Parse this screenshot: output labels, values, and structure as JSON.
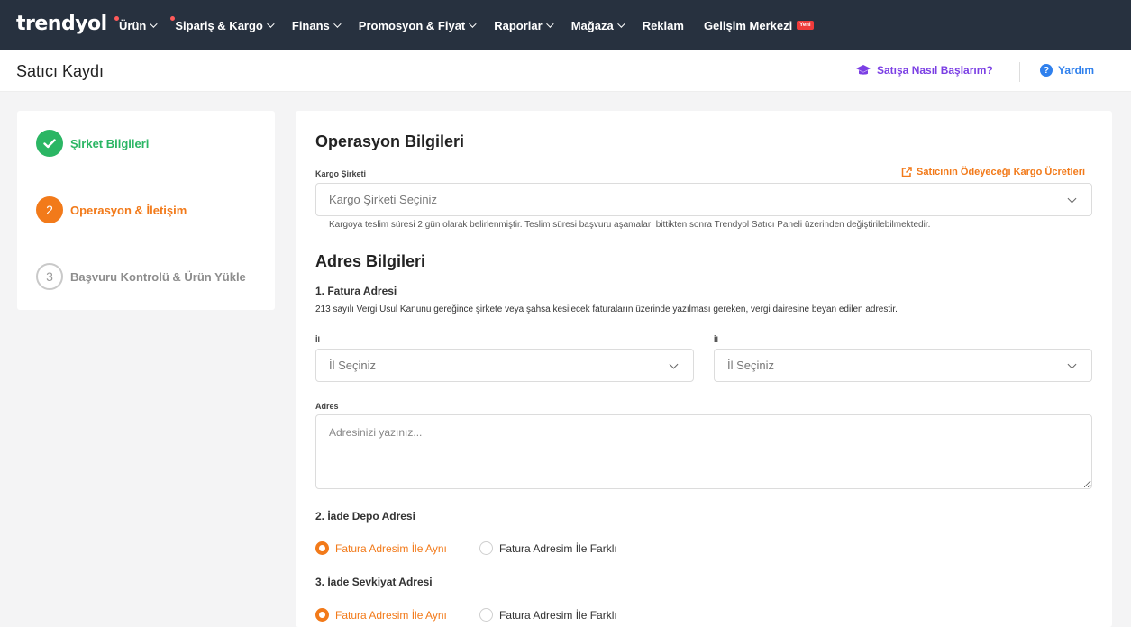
{
  "brand": {
    "logo_text": "trendyol"
  },
  "nav": {
    "items": [
      {
        "label": "Ürün",
        "dot": true
      },
      {
        "label": "Sipariş & Kargo",
        "dot": true
      },
      {
        "label": "Finans"
      },
      {
        "label": "Promosyon & Fiyat"
      },
      {
        "label": "Raporlar"
      },
      {
        "label": "Mağaza"
      },
      {
        "label": "Reklam"
      },
      {
        "label": "Gelişim Merkezi",
        "badge": "Yeni"
      }
    ]
  },
  "header": {
    "title": "Satıcı Kaydı",
    "how_to_start": "Satışa Nasıl Başlarım?",
    "help": "Yardım"
  },
  "stepper": {
    "steps": [
      {
        "number": "1",
        "label": "Şirket Bilgileri",
        "status": "done"
      },
      {
        "number": "2",
        "label": "Operasyon & İletişim",
        "status": "active"
      },
      {
        "number": "3",
        "label": "Başvuru Kontrolü & Ürün Yükle",
        "status": "pending"
      }
    ]
  },
  "form": {
    "operation_title": "Operasyon Bilgileri",
    "cargo_label": "Kargo Şirketi",
    "cargo_fees_link": "Satıcının Ödeyeceği Kargo Ücretleri",
    "cargo_placeholder": "Kargo Şirketi Seçiniz",
    "cargo_note": "Kargoya teslim süresi 2 gün olarak belirlenmiştir. Teslim süresi başvuru aşamaları bittikten sonra Trendyol Satıcı Paneli üzerinden değiştirilebilmektedir.",
    "address_title": "Adres Bilgileri",
    "invoice_title": "1. Fatura Adresi",
    "invoice_desc": "213 sayılı Vergi Usul Kanunu gereğince şirkete veya şahsa kesilecek faturaların üzerinde yazılması gereken, vergi dairesine beyan edilen adrestir.",
    "city_label": "İl",
    "city_placeholder": "İl Seçiniz",
    "city2_label": "İl",
    "city2_placeholder": "İl Seçiniz",
    "address_label": "Adres",
    "address_placeholder": "Adresinizi yazınız...",
    "return_title": "2. İade Depo Adresi",
    "shipment_title": "3. İade Sevkiyat Adresi",
    "same_option": "Fatura Adresim İle Aynı",
    "diff_option": "Fatura Adresim İle Farklı"
  },
  "colors": {
    "nav_bg": "#27313f",
    "accent_orange": "#f27a1a",
    "success_green": "#2bb664",
    "purple": "#7b3fe4",
    "help_blue": "#2f80ed"
  },
  "icons": {
    "how_to_start": "graduation-cap-icon",
    "help": "question-circle-icon",
    "cargo_fees": "external-link-icon",
    "step_done": "check-icon",
    "select_caret": "chevron-down-icon"
  }
}
